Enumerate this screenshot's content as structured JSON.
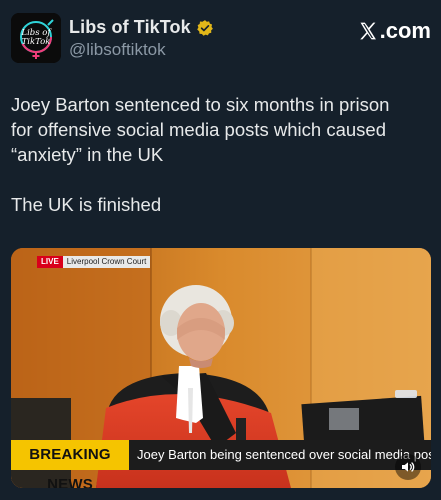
{
  "account": {
    "display_name": "Libs of TikTok",
    "handle": "@libsoftiktok",
    "avatar_text_top": "Libs of",
    "avatar_text_bottom": "TikTok",
    "avatar_icon": "libs-of-tiktok-logo-icon",
    "verified_icon": "verified-badge-icon"
  },
  "site": {
    "label": ".com",
    "icon": "x-logo-icon"
  },
  "tweet": {
    "line1": "Joey Barton sentenced to six months in  prison",
    "line2": "for offensive social media posts which caused",
    "line3": "“anxiety” in the UK",
    "line4": "The UK is finished"
  },
  "media": {
    "live_label": "LIVE",
    "location_label": "Liverpool Crown Court",
    "breaking_label": "BREAKING NEWS",
    "breaking_text": "Joey Barton being sentenced over social media posts",
    "volume_icon": "volume-icon"
  },
  "colors": {
    "background": "#15202b",
    "text": "#e7e9ea",
    "secondary_text": "#8b98a5",
    "verified_gold": "#e2b719",
    "breaking_yellow": "#f5c400",
    "live_red": "#d9001b"
  }
}
